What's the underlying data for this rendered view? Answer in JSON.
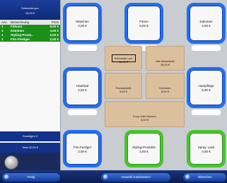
{
  "left_panel": {
    "header_line1": "Schneider.pur",
    "header_line2": "18,00 €",
    "columns": [
      "Anz.",
      "Bezeichnung",
      "Preis"
    ],
    "rows": [
      {
        "qty": "1",
        "name": "Föhnen",
        "price": "8,00 €"
      },
      {
        "qty": "1",
        "name": "Kämmen",
        "price": "4,00 €"
      },
      {
        "qty": "1",
        "name": "Styling-Produ..",
        "price": "2,00 €"
      },
      {
        "qty": "1",
        "name": "Fön-Festiger",
        "price": "2,00 €"
      }
    ],
    "box1": "Sonstiges 4",
    "box2": "Total 32,00 €"
  },
  "tiles": {
    "waschen": {
      "label": "Waschen",
      "price": "4,00 €"
    },
    "foenen": {
      "label": "Fönen",
      "price": "8,00 €"
    },
    "kaemmen": {
      "label": "Kämmen",
      "price": "4,00 €"
    },
    "haarbad": {
      "label": "Haarbad",
      "price": "2,50 €"
    },
    "haarpflege": {
      "label": "Haarpflege",
      "price": "5,90 €"
    },
    "foen_festiger": {
      "label": "Fön-Festiger",
      "price": "2,00 €"
    },
    "styling_produkte": {
      "label": "Styling-Produkte",
      "price": "2,00 €"
    },
    "spray_lack": {
      "label": "Spray, Lack",
      "price": "0,50 €"
    }
  },
  "center": {
    "schneiden_pur": {
      "label": "Schneiden pur",
      "price": "18,00 €"
    },
    "alle_neuschnitt": {
      "label": "alle Neuschnitt",
      "price": "18,00 €"
    },
    "fransschnitt": {
      "label": "Fransschnitt",
      "price": "9,00 €"
    },
    "konturen": {
      "label": "Konturen",
      "price": "8,00 €"
    },
    "pony_nacken": {
      "label": "Pony oder Nacken",
      "price": "4,00 €"
    }
  },
  "bottom_bar": {
    "fertig": "Fertig",
    "auswahl": "Auswahl zurücksetzen",
    "abbrechen": "Abbrechen"
  },
  "colors": {
    "blue_ring": "#1e6ff2",
    "green_ring": "#46c52b",
    "row_green": "#1a8f1a",
    "header_blue": "#12318a",
    "tan": "#dcc09e"
  }
}
